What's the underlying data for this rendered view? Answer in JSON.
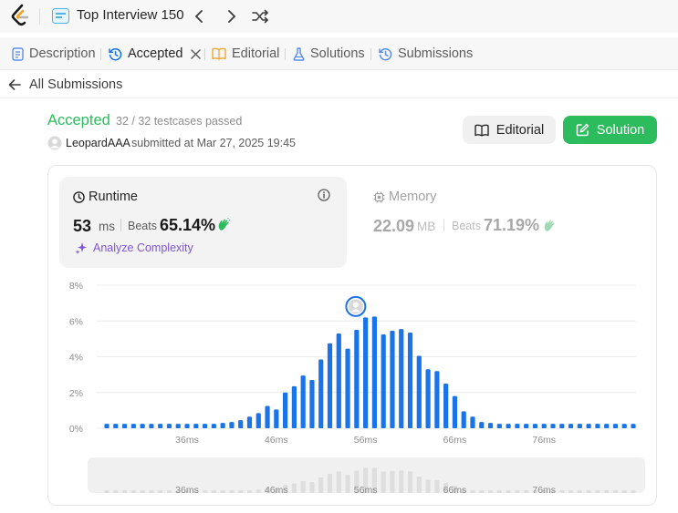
{
  "topbar": {
    "title": "Top Interview 150"
  },
  "tabs": [
    {
      "label": "Description"
    },
    {
      "label": "Accepted"
    },
    {
      "label": "Editorial"
    },
    {
      "label": "Solutions"
    },
    {
      "label": "Submissions"
    }
  ],
  "back": {
    "label": "All Submissions"
  },
  "result": {
    "status": "Accepted",
    "testcases": "32 / 32 testcases passed",
    "user": "LeopardAAA",
    "submitted": "submitted at Mar 27, 2025 19:45"
  },
  "buttons": {
    "editorial": "Editorial",
    "solution": "Solution"
  },
  "runtime": {
    "label": "Runtime",
    "value": "53",
    "unit": "ms",
    "beats_label": "Beats",
    "beats": "65.14%",
    "analyze": "Analyze Complexity"
  },
  "memory": {
    "label": "Memory",
    "value": "22.09",
    "unit": "MB",
    "beats_label": "Beats",
    "beats": "71.19%"
  },
  "colors": {
    "accent_green": "#2cbb5d",
    "bar_blue": "#1a73e8",
    "analyze_purple": "#7f56d9"
  },
  "chart_data": {
    "type": "bar",
    "y_ticks": [
      "0%",
      "2%",
      "4%",
      "6%",
      "8%"
    ],
    "ylim": [
      0,
      8
    ],
    "x_ticks": [
      {
        "value": 36,
        "label": "36ms"
      },
      {
        "value": 46,
        "label": "46ms"
      },
      {
        "value": 56,
        "label": "56ms"
      },
      {
        "value": 66,
        "label": "66ms"
      },
      {
        "value": 76,
        "label": "76ms"
      }
    ],
    "x_start": 27,
    "x_step": 1,
    "values": [
      0.25,
      0.25,
      0.25,
      0.25,
      0.25,
      0.25,
      0.25,
      0.25,
      0.25,
      0.25,
      0.25,
      0.25,
      0.25,
      0.3,
      0.35,
      0.45,
      0.65,
      0.85,
      1.25,
      1.05,
      2.0,
      2.35,
      2.95,
      2.7,
      3.85,
      4.75,
      5.3,
      4.45,
      5.5,
      6.2,
      6.25,
      5.25,
      5.45,
      5.55,
      5.35,
      4.05,
      3.3,
      3.2,
      2.5,
      1.8,
      0.95,
      0.65,
      0.35,
      0.3,
      0.25,
      0.25,
      0.25,
      0.25,
      0.25,
      0.25,
      0.25,
      0.25,
      0.25,
      0.25,
      0.25,
      0.25,
      0.25,
      0.25,
      0.25,
      0.25
    ],
    "highlight_value": 56,
    "grid": true,
    "has_range_slider": true
  }
}
